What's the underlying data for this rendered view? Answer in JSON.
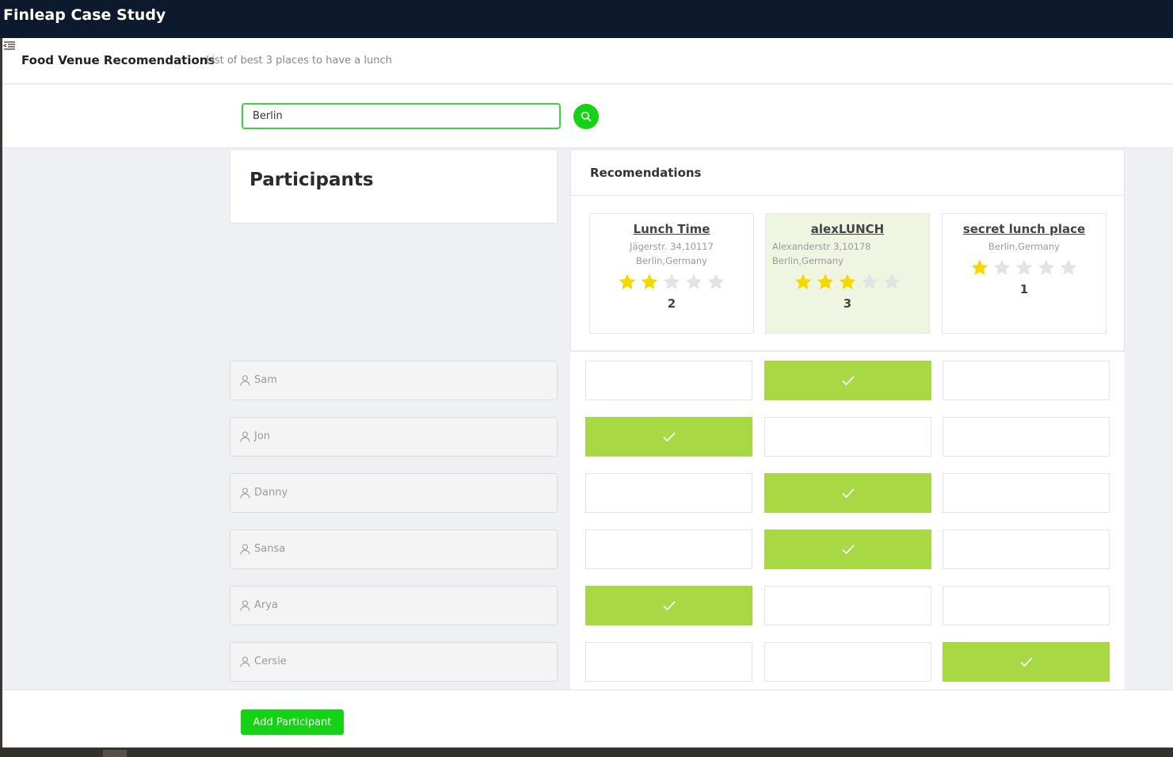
{
  "app": {
    "title": "Finleap Case Study"
  },
  "header": {
    "title": "Food Venue Recomendations",
    "subtitle": "List of best 3 places to have a lunch"
  },
  "search": {
    "value": "Berlin"
  },
  "participants": {
    "title": "Participants",
    "names": [
      "Sam",
      "Jon",
      "Danny",
      "Sansa",
      "Arya",
      "Cersie"
    ]
  },
  "recommendations": {
    "title": "Recomendations",
    "venues": [
      {
        "name": "Lunch Time",
        "address": "Jägerstr. 34,10117 Berlin,Germany",
        "rating": 2,
        "max_rating": 5,
        "votes": "2",
        "highlighted": false
      },
      {
        "name": "alexLUNCH",
        "address": "Alexanderstr 3,10178 Berlin,Germany",
        "rating": 3,
        "max_rating": 5,
        "votes": "3",
        "highlighted": true
      },
      {
        "name": "secret lunch place",
        "address": "Berlin,Germany",
        "rating": 1,
        "max_rating": 5,
        "votes": "1",
        "highlighted": false
      }
    ]
  },
  "votes": [
    1,
    0,
    1,
    1,
    0,
    2
  ],
  "footer": {
    "add_label": "Add Participant"
  },
  "colors": {
    "topbar": "#0d1a2e",
    "accent": "#14d314",
    "vote": "#a8d843",
    "highlight_card": "#eef6e2",
    "star_on": "#f5d800",
    "star_off": "#e3e3e3"
  },
  "icons": {
    "menu": "menu-collapse-icon",
    "search": "search-icon",
    "participant": "user-icon",
    "vote": "check-icon",
    "rating": "star-icon"
  }
}
